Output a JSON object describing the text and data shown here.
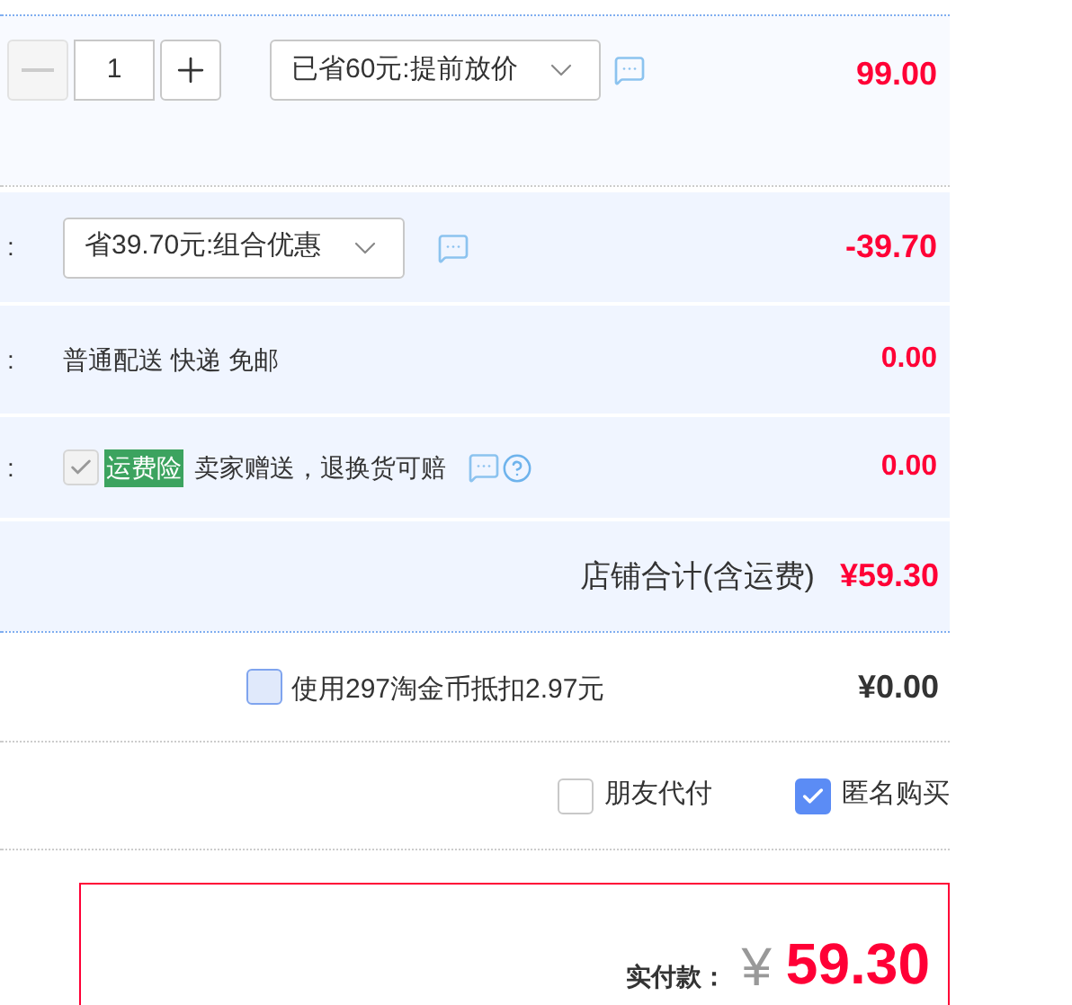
{
  "item_row": {
    "quantity": "1",
    "minus_disabled": true,
    "promo": "已省60元:提前放价",
    "price": "99.00"
  },
  "discount_row": {
    "label": ":",
    "promo": "省39.70元:组合优惠",
    "amount": "-39.70"
  },
  "shipping_row": {
    "label": ":",
    "text": "普通配送 快递 免邮",
    "amount": "0.00"
  },
  "insurance_row": {
    "label": ":",
    "checked": true,
    "disabled": true,
    "tag": "运费险",
    "text": "卖家赠送，退换货可赔",
    "amount": "0.00"
  },
  "shop_total": {
    "label": "店铺合计(含运费)",
    "amount": "¥59.30"
  },
  "coins": {
    "checked": false,
    "text": "使用297淘金币抵扣2.97元",
    "amount": "¥0.00"
  },
  "options": [
    {
      "label": "朋友代付",
      "checked": false
    },
    {
      "label": "匿名购买",
      "checked": true
    }
  ],
  "payment": {
    "label": "实付款：",
    "currency": "¥",
    "amount": "59.30"
  }
}
